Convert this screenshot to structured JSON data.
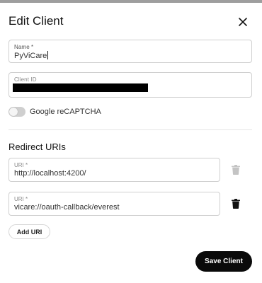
{
  "dialog": {
    "title": "Edit Client",
    "close_icon": "close-icon"
  },
  "form": {
    "name": {
      "label": "Name *",
      "value": "PyViCare"
    },
    "client_id": {
      "label": "Client ID",
      "value_redacted": true
    },
    "recaptcha": {
      "label": "Google reCAPTCHA",
      "enabled": false
    }
  },
  "redirect": {
    "title": "Redirect URIs",
    "uris": [
      {
        "label": "URI *",
        "value": "http://localhost:4200/",
        "delete_enabled": false
      },
      {
        "label": "URI *",
        "value": "vicare://oauth-callback/everest",
        "delete_enabled": true
      }
    ],
    "add_label": "Add URI"
  },
  "actions": {
    "save_label": "Save Client"
  },
  "colors": {
    "primary_button": "#0a0a0a",
    "border": "#cfcfcf",
    "disabled_icon": "#c4c4c4"
  }
}
